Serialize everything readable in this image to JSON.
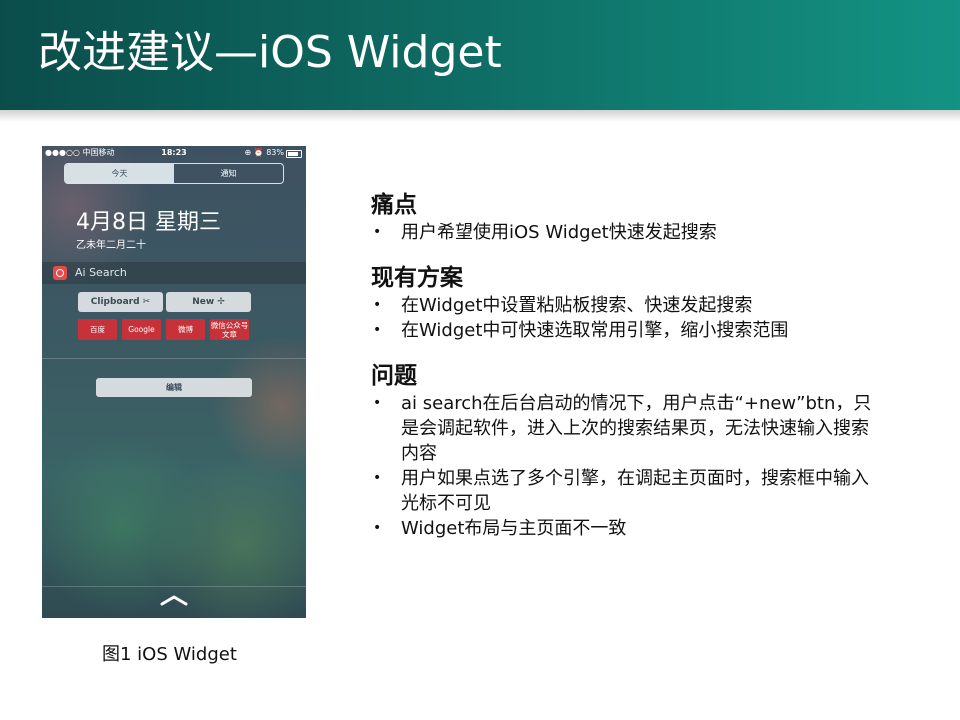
{
  "slide": {
    "title": "改进建议—iOS Widget",
    "caption": "图1 iOS Widget",
    "colors": {
      "header_dark": "#0b4d4a",
      "header_light": "#139383"
    }
  },
  "phone": {
    "status": {
      "carrier": "●●●○○ 中国移动",
      "time": "18:23",
      "battery_text": "83%",
      "battery_level": 0.83
    },
    "segments": [
      "今天",
      "通知"
    ],
    "active_segment": 0,
    "date": "4月8日 星期三",
    "lunar_date": "乙未年二月二十",
    "widget": {
      "name": "Ai Search",
      "icon": "ai-search-app-icon",
      "primary_buttons": [
        "Clipboard ✂",
        "New ✢"
      ],
      "engine_buttons": [
        "百度",
        "Google",
        "微博",
        "微信公众号文章"
      ]
    },
    "edit_label": "编辑",
    "handle_icon": "chevron-up-icon"
  },
  "content": {
    "sections": [
      {
        "title": "痛点",
        "bullets": [
          "用户希望使用iOS  Widget快速发起搜索"
        ]
      },
      {
        "title": "现有方案",
        "bullets": [
          "在Widget中设置粘贴板搜索、快速发起搜索",
          "在Widget中可快速选取常用引擎，缩小搜索范围"
        ]
      },
      {
        "title": "问题",
        "bullets": [
          "ai search在后台启动的情况下，用户点击“+new”btn，只是会调起软件，进入上次的搜索结果页，无法快速输入搜索内容",
          "用户如果点选了多个引擎，在调起主页面时，搜索框中输入光标不可见",
          "Widget布局与主页面不一致"
        ]
      }
    ]
  }
}
